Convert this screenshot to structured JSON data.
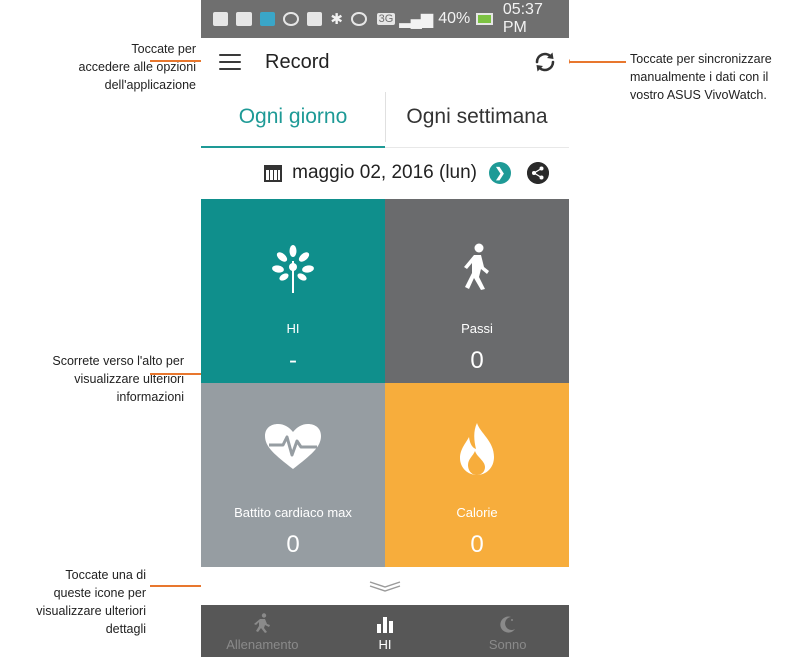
{
  "annotations": {
    "menu": "Toccate per\naccedere alle opzioni\ndell'applicazione",
    "sync": "Toccate per sincronizzare\nmanualmente i dati con il\nvostro ASUS VivoWatch.",
    "scroll": "Scorrete verso l'alto per\nvisualizzare ulteriori\ninformazioni",
    "icons": "Toccate una di\nqueste icone per\nvisualizzare ulteriori\ndettagli"
  },
  "status_bar": {
    "network": "3G",
    "battery": "40%",
    "time": "05:37 PM"
  },
  "toolbar": {
    "title": "Record",
    "menu_icon": "hamburger-menu-icon",
    "sync_icon": "sync-icon"
  },
  "tabs": [
    {
      "label": "Ogni giorno",
      "active": true
    },
    {
      "label": "Ogni settimana",
      "active": false
    }
  ],
  "date": {
    "text": "maggio 02, 2016 (lun)",
    "calendar_icon": "calendar-icon",
    "next_icon": "chevron-right-icon",
    "share_icon": "share-icon"
  },
  "tiles": [
    {
      "id": "hi",
      "label": "HI",
      "value": "-",
      "icon": "tree-icon",
      "color": "#0f8f8c"
    },
    {
      "id": "steps",
      "label": "Passi",
      "value": "0",
      "icon": "walking-person-icon",
      "color": "#6a6b6d"
    },
    {
      "id": "heart",
      "label": "Battito cardiaco max",
      "value": "0",
      "icon": "heart-pulse-icon",
      "color": "#969da2"
    },
    {
      "id": "calories",
      "label": "Calorie",
      "value": "0",
      "icon": "flame-icon",
      "color": "#f7ad3c"
    }
  ],
  "bottom_nav": [
    {
      "label": "Allenamento",
      "icon": "running-icon",
      "active": false
    },
    {
      "label": "HI",
      "icon": "bar-chart-icon",
      "active": true
    },
    {
      "label": "Sonno",
      "icon": "moon-icon",
      "active": false
    }
  ],
  "colors": {
    "accent": "#1e9a96",
    "annotation": "#e8772e"
  }
}
